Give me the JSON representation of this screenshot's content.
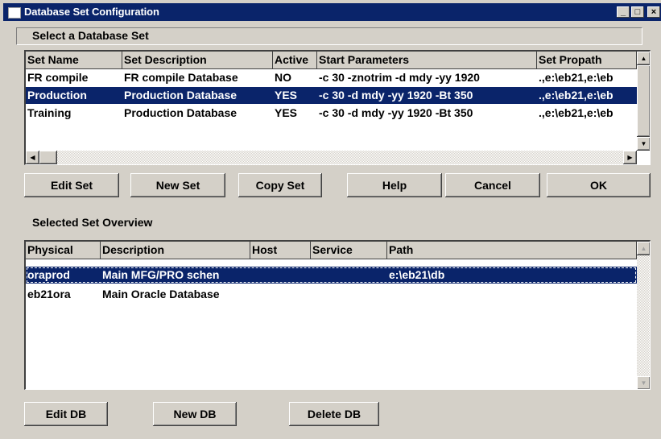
{
  "window": {
    "title": "Database Set Configuration",
    "minimize": "_",
    "maximize": "□",
    "close": "×"
  },
  "set_group": {
    "label": "Select a Database Set",
    "columns": [
      "Set Name",
      "Set Description",
      "Active",
      "Start Parameters",
      "Set Propath"
    ],
    "rows": [
      {
        "name": "FR compile",
        "description": "FR compile Database",
        "active": "NO",
        "params": "-c 30 -znotrim -d mdy -yy 1920",
        "propath": ".,e:\\eb21,e:\\eb"
      },
      {
        "name": "Production",
        "description": "Production Database",
        "active": "YES",
        "params": "-c 30 -d mdy -yy 1920 -Bt 350",
        "propath": ".,e:\\eb21,e:\\eb"
      },
      {
        "name": "Training",
        "description": "Production Database",
        "active": "YES",
        "params": "-c 30 -d mdy -yy 1920 -Bt 350",
        "propath": ".,e:\\eb21,e:\\eb"
      }
    ],
    "selected_index": 1
  },
  "buttons": {
    "edit_set": "Edit Set",
    "new_set": "New Set",
    "copy_set": "Copy Set",
    "help": "Help",
    "cancel": "Cancel",
    "ok": "OK"
  },
  "overview": {
    "label": "Selected Set Overview",
    "columns": [
      "Physical",
      "Description",
      "Host",
      "Service",
      "Path"
    ],
    "rows": [
      {
        "physical": "oraprod",
        "description": "Main MFG/PRO schen",
        "host": "",
        "service": "",
        "path": "e:\\eb21\\db"
      },
      {
        "physical": "eb21ora",
        "description": "Main Oracle Database",
        "host": "",
        "service": "",
        "path": ""
      }
    ],
    "selected_index": 0
  },
  "db_buttons": {
    "edit_db": "Edit DB",
    "new_db": "New DB",
    "delete_db": "Delete DB"
  },
  "icons": [
    "app-icon",
    "minimize-icon",
    "maximize-icon",
    "close-icon",
    "scroll-up-icon",
    "scroll-down-icon",
    "scroll-left-icon",
    "scroll-right-icon"
  ],
  "colors": {
    "selection": "#0a246a",
    "face": "#d4d0c8",
    "titlebar": "#0a246a"
  }
}
